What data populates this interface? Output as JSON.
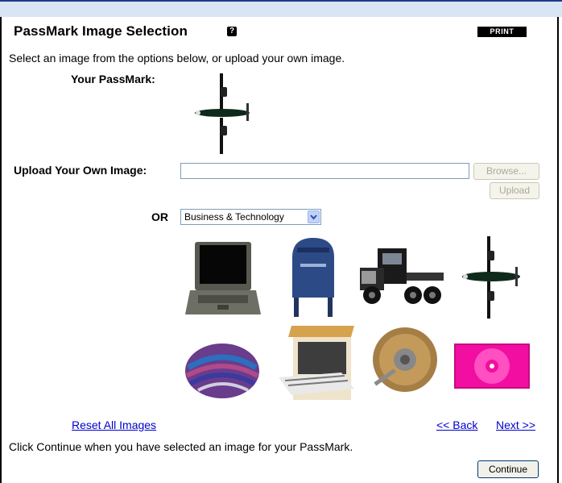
{
  "header": {
    "title": "PassMark Image Selection",
    "help_icon_glyph": "?",
    "print_label": "PRINT"
  },
  "instruction": "Select an image from the options below, or upload your own image.",
  "passmark": {
    "label": "Your PassMark:",
    "current_image": "airplane"
  },
  "upload": {
    "label": "Upload Your Own Image:",
    "value": "",
    "browse_label": "Browse...",
    "upload_label": "Upload"
  },
  "category": {
    "or_label": "OR",
    "selected": "Business & Technology"
  },
  "gallery": [
    {
      "name": "laptop"
    },
    {
      "name": "mailbox"
    },
    {
      "name": "semi-truck"
    },
    {
      "name": "airplane"
    },
    {
      "name": "yarn"
    },
    {
      "name": "dishwasher"
    },
    {
      "name": "wire-brush"
    },
    {
      "name": "cd-case"
    }
  ],
  "links": {
    "reset": "Reset All Images",
    "back": "<< Back",
    "next": "Next >>"
  },
  "footer": {
    "instruction": "Click Continue when you have selected an image for your PassMark.",
    "continue_label": "Continue"
  },
  "colors": {
    "top_band": "#d9e4f5",
    "link": "#0000cc",
    "frame": "#000000"
  }
}
